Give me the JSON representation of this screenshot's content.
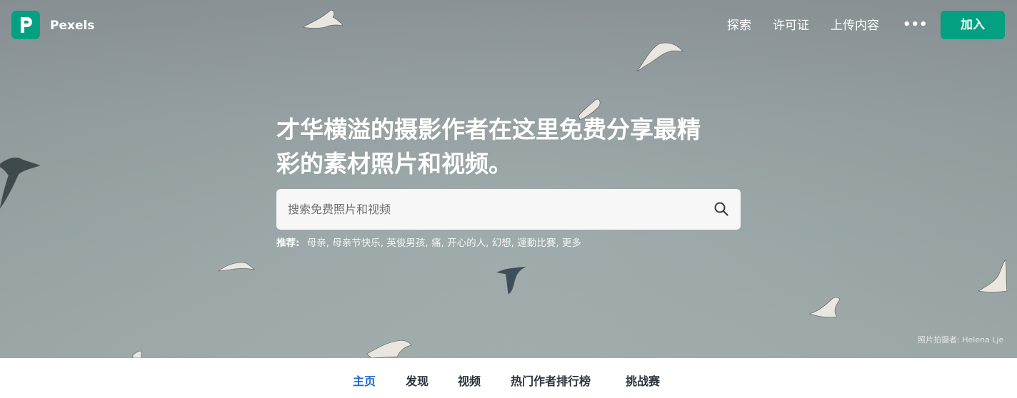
{
  "header": {
    "brand": "Pexels",
    "nav": [
      {
        "label": "探索"
      },
      {
        "label": "许可证"
      },
      {
        "label": "上传内容"
      }
    ],
    "more_label": "•••",
    "join_label": "加入"
  },
  "hero": {
    "headline_line1": "才华横溢的摄影作者在这里免费分享最精",
    "headline_line2": "彩的素材照片和视频。",
    "search": {
      "placeholder": "搜索免费照片和视频",
      "value": ""
    },
    "suggestions": {
      "label": "推荐:",
      "items": [
        "母亲,",
        "母亲节快乐,",
        "英俊男孩,",
        "痛,",
        "开心的人,",
        "幻想,",
        "運動比賽,",
        "更多"
      ]
    },
    "credit": "照片拍摄者: Helena Lje"
  },
  "tabs": [
    {
      "label": "主页",
      "active": true
    },
    {
      "label": "发现",
      "active": false
    },
    {
      "label": "视频",
      "active": false
    },
    {
      "label": "热门作者排行榜",
      "active": false
    },
    {
      "label": "挑战赛",
      "active": false
    }
  ],
  "colors": {
    "brand_green": "#05a081",
    "active_tab": "#1a68d3",
    "tab_text": "#2c343e"
  },
  "icons": {
    "logo": "pexels-logo-icon",
    "search": "search-icon",
    "more": "more-dots-icon"
  }
}
